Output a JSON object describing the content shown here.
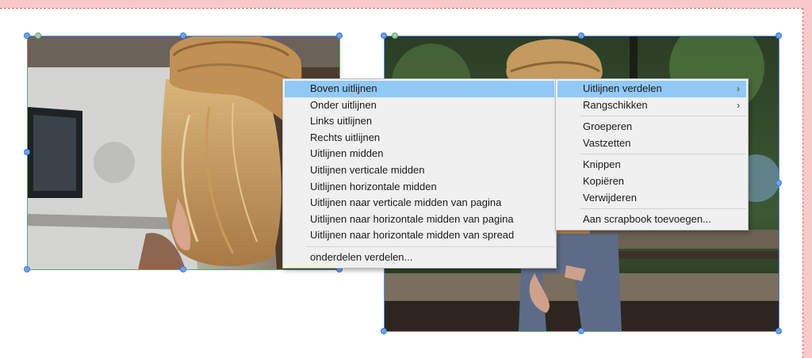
{
  "colors": {
    "highlight": "#91c9f7",
    "selection_handle": "#6fa3ea",
    "page_guide": "#e06060",
    "pasteboard": "#f7c9c9"
  },
  "photos": [
    {
      "name": "photo-woman-straw-hat-truck"
    },
    {
      "name": "photo-woman-sitting-bench"
    }
  ],
  "context_menu": {
    "items": [
      {
        "label": "Boven uitlijnen",
        "highlighted": true
      },
      {
        "label": "Onder uitlijnen"
      },
      {
        "label": "Links uitlijnen"
      },
      {
        "label": "Rechts uitlijnen"
      },
      {
        "label": "Uitlijnen midden"
      },
      {
        "label": "Uitlijnen verticale midden"
      },
      {
        "label": "Uitlijnen horizontale midden"
      },
      {
        "label": "Uitlijnen naar verticale midden van pagina"
      },
      {
        "label": "Uitlijnen naar horizontale midden van pagina"
      },
      {
        "label": "Uitlijnen naar horizontale midden van spread"
      }
    ],
    "footer_item": {
      "label": "onderdelen verdelen..."
    }
  },
  "parent_menu": {
    "items": [
      {
        "label": "Uitlijnen verdelen",
        "submenu_arrow": "›",
        "highlighted": true
      },
      {
        "label": "Rangschikken",
        "submenu_arrow": "›"
      },
      {
        "label": "Groeperen"
      },
      {
        "label": "Vastzetten"
      },
      {
        "label": "Knippen"
      },
      {
        "label": "Kopiëren"
      },
      {
        "label": "Verwijderen"
      },
      {
        "label": "Aan scrapbook toevoegen..."
      }
    ]
  }
}
